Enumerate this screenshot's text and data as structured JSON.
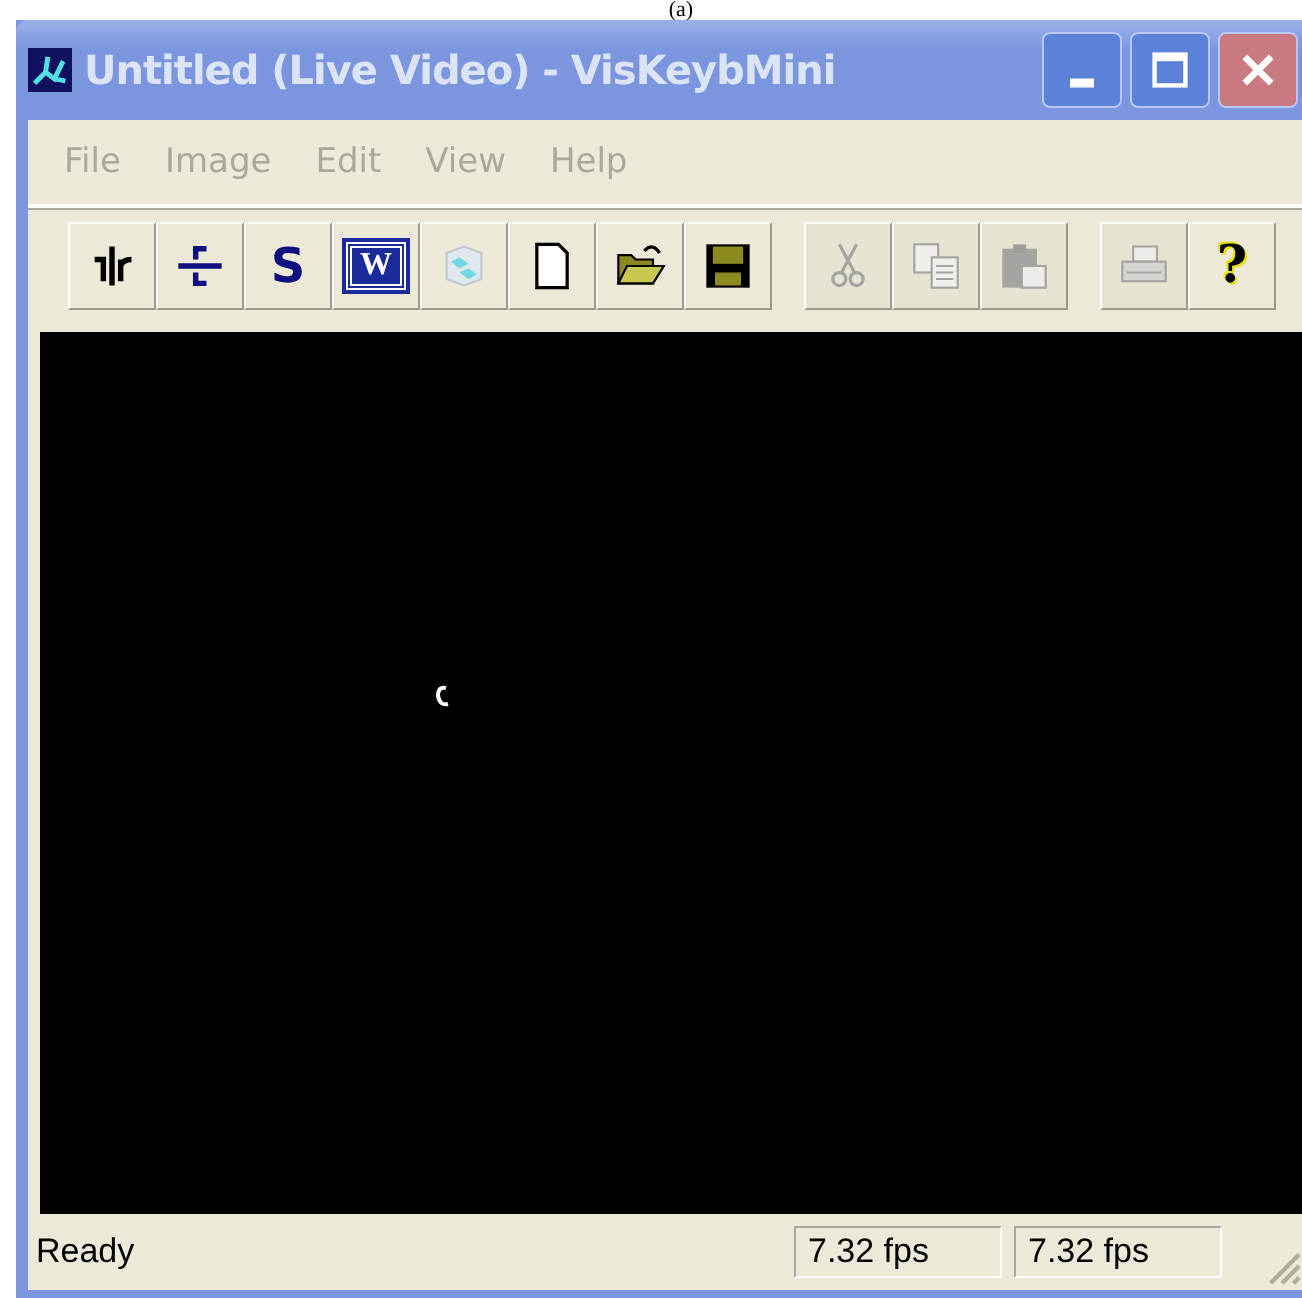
{
  "caption": "(a)",
  "window": {
    "title": "Untitled (Live Video) - VisKeybMini",
    "active": false
  },
  "menu": [
    {
      "label": "File",
      "disabled": true
    },
    {
      "label": "Image",
      "disabled": true
    },
    {
      "label": "Edit",
      "disabled": true
    },
    {
      "label": "View",
      "disabled": true
    },
    {
      "label": "Help",
      "disabled": true
    }
  ],
  "toolbar": [
    {
      "buttons": [
        {
          "kind": "split-vertical",
          "disabled": false
        },
        {
          "kind": "split-horizontal",
          "disabled": false
        },
        {
          "kind": "letter",
          "label": "S",
          "disabled": false
        },
        {
          "kind": "boxed-letter",
          "label": "W",
          "disabled": false
        },
        {
          "kind": "cubes",
          "disabled": false
        },
        {
          "kind": "new",
          "disabled": false
        },
        {
          "kind": "open",
          "disabled": false
        },
        {
          "kind": "save",
          "disabled": false
        }
      ]
    },
    {
      "buttons": [
        {
          "kind": "cut",
          "disabled": true
        },
        {
          "kind": "copy",
          "disabled": true
        },
        {
          "kind": "paste",
          "disabled": true
        }
      ]
    },
    {
      "buttons": [
        {
          "kind": "print",
          "disabled": true
        },
        {
          "kind": "help",
          "label": "?",
          "disabled": false
        }
      ]
    }
  ],
  "status_bar": {
    "message": "Ready",
    "panes": [
      "7.32 fps",
      "7.32 fps"
    ]
  }
}
